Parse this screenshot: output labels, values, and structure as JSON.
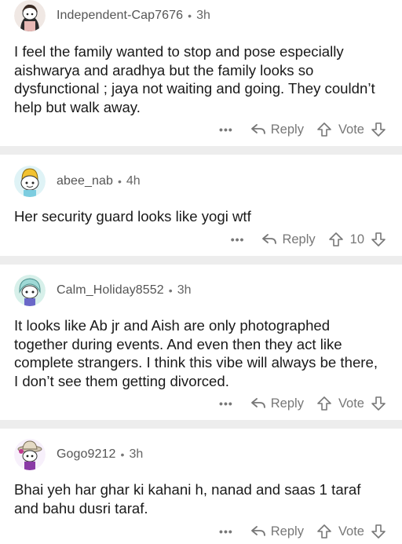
{
  "comments": [
    {
      "username": "Independent-Cap7676",
      "time": "3h",
      "text": "I feel the family wanted to stop and pose especially aishwarya and aradhya but the family looks so dysfunctional ; jaya not waiting and going. They couldn’t help but walk away.",
      "reply_label": "Reply",
      "vote_label": "Vote",
      "more": "•••",
      "separator": "•",
      "avatar_icon": "snoo-avatar-dark-hair-icon"
    },
    {
      "username": "abee_nab",
      "time": "4h",
      "text": "Her security guard looks like yogi wtf",
      "reply_label": "Reply",
      "vote_label": "10",
      "more": "•••",
      "separator": "•",
      "avatar_icon": "snoo-avatar-banana-icon"
    },
    {
      "username": "Calm_Holiday8552",
      "time": "3h",
      "text": "It looks like Ab jr and Aish are only photographed together during events. And even then they act like complete strangers. I think this vibe will always be there, I don’t see them getting divorced.",
      "reply_label": "Reply",
      "vote_label": "Vote",
      "more": "•••",
      "separator": "•",
      "avatar_icon": "snoo-avatar-teal-hair-icon"
    },
    {
      "username": "Gogo9212",
      "time": "3h",
      "text": "Bhai yeh har ghar ki kahani h, nanad and saas 1 taraf and bahu dusri taraf.",
      "reply_label": "Reply",
      "vote_label": "Vote",
      "more": "•••",
      "separator": "•",
      "avatar_icon": "snoo-avatar-hat-icon"
    }
  ],
  "colors": {
    "background": "#ededed",
    "card": "#ffffff",
    "meta_text": "#666666",
    "icon": "#777777"
  }
}
